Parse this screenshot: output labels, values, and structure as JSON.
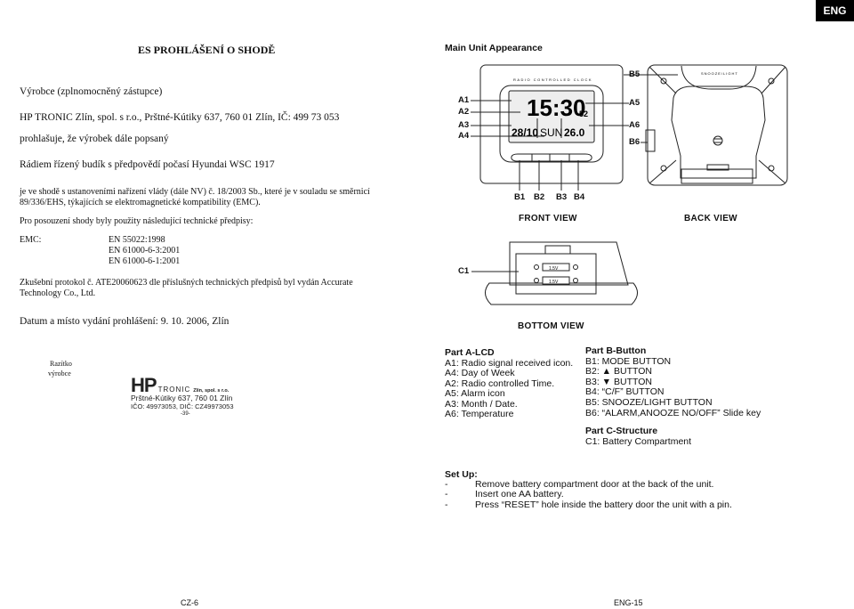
{
  "badge": "ENG",
  "left": {
    "title": "ES PROHLÁŠENÍ O SHODĚ",
    "manufacturer_label": "Výrobce (zplnomocněný zástupce)",
    "manufacturer": "HP TRONIC Zlín, spol. s r.o., Prštné-Kútiky 637, 760 01 Zlín, IČ: 499 73 053",
    "declares": "prohlašuje, že výrobek dále popsaný",
    "product": "Rádiem řízený budík s předpovědí počasí Hyundai WSC 1917",
    "compliance_1": "je ve shodě s ustanoveními nařízení vlády (dále NV) č. 18/2003 Sb., které je v souladu se směrnicí",
    "compliance_2": "89/336/EHS, týkajících se elektromagnetické kompatibility (EMC).",
    "standards_intro": "Pro posouzení shody byly použity následující technické předpisy:",
    "emc_label": "EMC:",
    "standards": [
      "EN 55022:1998",
      "EN 61000-6-3:2001",
      "EN 61000-6-1:2001"
    ],
    "protocol_1": "Zkušební protokol č. ATE20060623 dle příslušných technických předpisů byl vydán Accurate",
    "protocol_2": "Technology Co., Ltd.",
    "date_place": "Datum a místo vydání prohlášení: 9. 10. 2006, Zlín",
    "stamp_label_1": "Razítko",
    "stamp_label_2": "výrobce",
    "stamp": {
      "logo": "HP",
      "brand": "TRONIC",
      "suffix": "Zlín, spol. s r.o.",
      "address": "Prštné-Kútiky 637, 760 01 Zlín",
      "ids": "IČO: 49973053, DIČ: CZ49973053",
      "number": "-39-"
    },
    "footer": "CZ-6"
  },
  "right": {
    "heading": "Main Unit Appearance",
    "diagram": {
      "front_title": "RADIO CONTROLLED CLOCK",
      "time": "15:30",
      "seconds": "52",
      "date": "28/10",
      "day": "SUN",
      "temp": "26.0",
      "snooze_label": "SNOOZE/LIGHT",
      "battery_label": "1.5V",
      "callouts": {
        "A1": "A1",
        "A2": "A2",
        "A3": "A3",
        "A4": "A4",
        "A5": "A5",
        "A6": "A6",
        "B1": "B1",
        "B2": "B2",
        "B3": "B3",
        "B4": "B4",
        "B5": "B5",
        "B6": "B6",
        "C1": "C1"
      },
      "front_view": "FRONT VIEW",
      "back_view": "BACK VIEW",
      "bottom_view": "BOTTOM VIEW"
    },
    "part_a": {
      "title": "Part A-LCD",
      "items": [
        "A1: Radio signal received icon.",
        "A4: Day of Week",
        "A2: Radio controlled Time.",
        "A5: Alarm icon",
        "A3: Month / Date.",
        "A6: Temperature"
      ]
    },
    "part_b": {
      "title": "Part B-Button",
      "items": [
        "B1: MODE BUTTON",
        "B2:  ▲ BUTTON",
        "B3:  ▼ BUTTON",
        "B4: “C/F” BUTTON",
        "B5: SNOOZE/LIGHT BUTTON",
        "B6: “ALARM,ANOOZE NO/OFF” Slide key"
      ]
    },
    "part_c": {
      "title": "Part C-Structure",
      "items": [
        "C1: Battery Compartment"
      ]
    },
    "setup": {
      "title": "Set Up:",
      "bullet": "-",
      "items": [
        "Remove battery compartment door at the back of the unit.",
        "Insert one AA battery.",
        "Press “RESET” hole inside the battery door the unit with a pin."
      ]
    },
    "footer": "ENG-15"
  }
}
